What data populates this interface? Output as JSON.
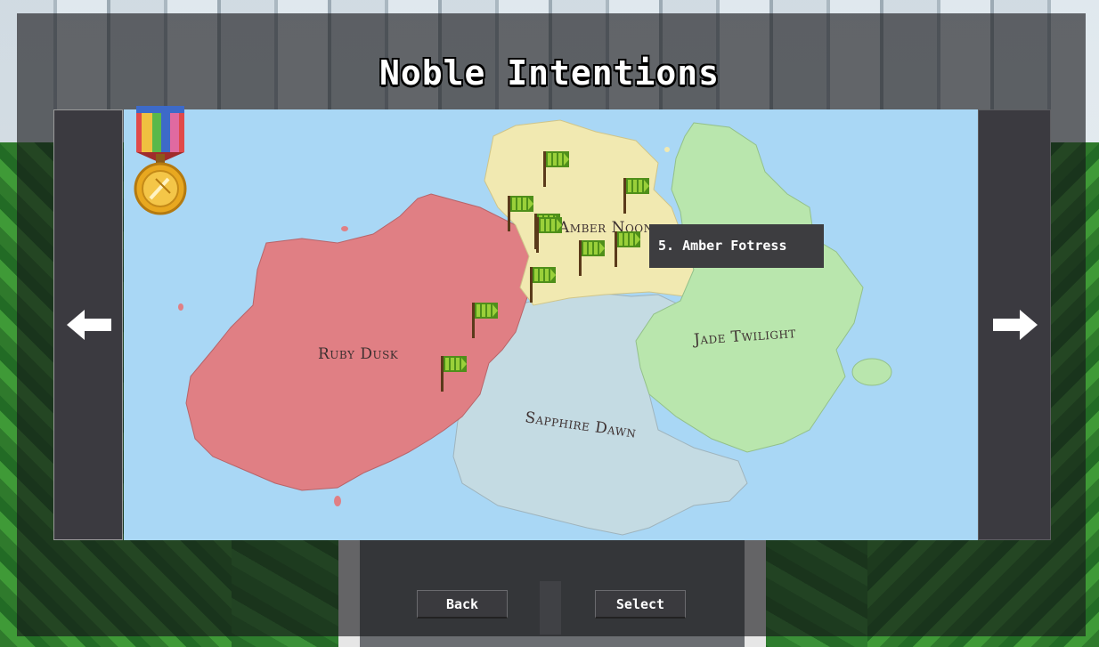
{
  "title": "Noble Intentions",
  "map": {
    "regions": [
      {
        "name": "Ruby Dusk",
        "color": "#e07f84"
      },
      {
        "name": "Amber Noon",
        "color": "#f1e9b1"
      },
      {
        "name": "Jade Twilight",
        "color": "#b9e6ad"
      },
      {
        "name": "Sapphire Dawn",
        "color": "#c4dbe3"
      }
    ],
    "ocean_color": "#a9d7f5",
    "flags_count": 10,
    "tooltip": "5. Amber Fotress"
  },
  "navigation": {
    "prev_icon": "arrow-left-icon",
    "next_icon": "arrow-right-icon"
  },
  "medal_icon": "gold-medal-icon",
  "buttons": {
    "back_label": "Back",
    "select_label": "Select"
  }
}
